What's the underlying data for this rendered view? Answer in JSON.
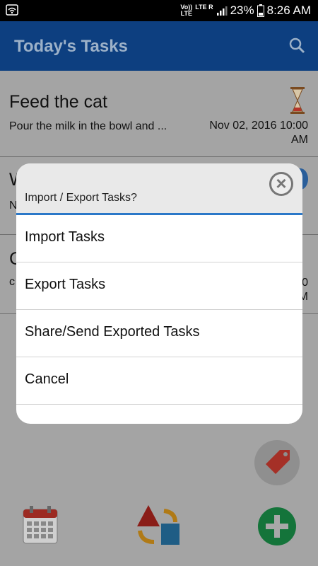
{
  "status_bar": {
    "network_top": "Vo))",
    "network_bottom": "LTE",
    "lte_label": "LTE",
    "roaming": "R",
    "battery": "23%",
    "time": "8:26 AM"
  },
  "app_bar": {
    "title": "Today's Tasks",
    "search_icon": "search-icon"
  },
  "tasks": [
    {
      "title": "Feed the cat",
      "description": "Pour the milk in the bowl and ...",
      "date_line1": "Nov 02, 2016 10:00",
      "date_line2": "AM",
      "icon": "hourglass-icon"
    },
    {
      "title": "W",
      "description": "N",
      "date_line1": "",
      "date_line2": ""
    },
    {
      "title": "C",
      "description": "c",
      "date_line1": "0",
      "date_line2": "M"
    }
  ],
  "dialog": {
    "title": "Import / Export Tasks?",
    "options": [
      {
        "label": "Import Tasks"
      },
      {
        "label": "Export Tasks"
      },
      {
        "label": "Share/Send Exported Tasks"
      },
      {
        "label": "Cancel"
      }
    ]
  },
  "bottom_bar": {
    "icons": [
      "calendar-icon",
      "shapes-swap-icon",
      "add-task-icon"
    ],
    "fab_icon": "tag-icon"
  },
  "colors": {
    "app_bar": "#0d3f80",
    "accent_line": "#2b78c8",
    "add_button": "#1e8f45",
    "tag": "#c0392b"
  }
}
